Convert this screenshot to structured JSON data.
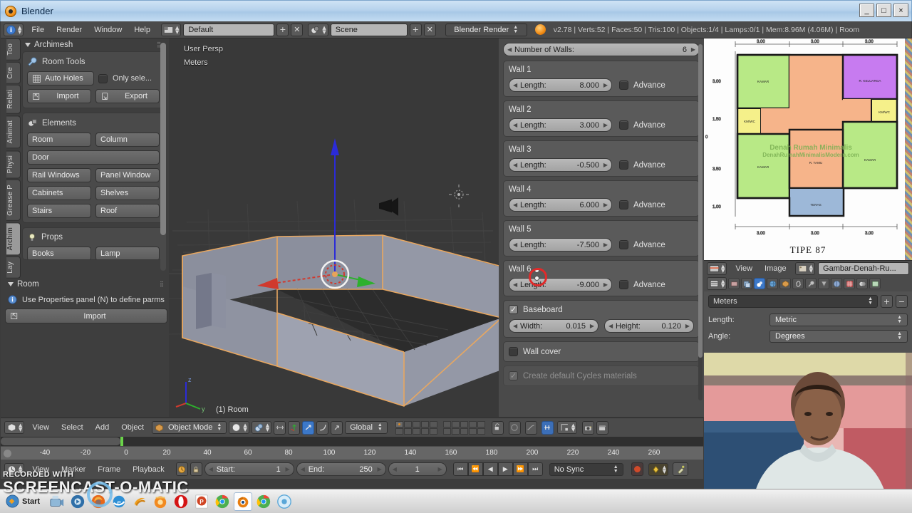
{
  "window": {
    "title": "Blender",
    "app_icon": "blender-logo-icon",
    "controls": {
      "minimize": "_",
      "maximize": "□",
      "close": "×"
    }
  },
  "info_header": {
    "editor_icon": "info-editor-icon",
    "menus": [
      "File",
      "Render",
      "Window",
      "Help"
    ],
    "screen_layout_icon": "screen-layout-icon",
    "screen_layout": "Default",
    "add_screen": "+",
    "delete_screen": "✕",
    "scene_icon": "scene-icon",
    "scene": "Scene",
    "add_scene": "+",
    "delete_scene": "✕",
    "render_engine": "Blender Render",
    "blender_icon": "blender-logo-icon",
    "stats": "v2.78 | Verts:52 | Faces:50 | Tris:100 | Objects:1/4 | Lamps:0/1 | Mem:8.96M (4.06M) | Room"
  },
  "tool_shelf": {
    "tabs": [
      {
        "label": "Too",
        "active": false
      },
      {
        "label": "Cre",
        "active": false
      },
      {
        "label": "Relati",
        "active": false
      },
      {
        "label": "Animat",
        "active": false
      },
      {
        "label": "Physi",
        "active": false
      },
      {
        "label": "Grease P",
        "active": false
      },
      {
        "label": "Archim",
        "active": true
      },
      {
        "label": "Lay",
        "active": false
      }
    ],
    "archimesh": {
      "title": "Archimesh",
      "room_tools": {
        "header": "Room Tools",
        "header_icon": "wrench-icon",
        "auto_holes": "Auto Holes",
        "auto_holes_icon": "grid-holes-icon",
        "only_selected": "Only sele...",
        "only_selected_checked": false,
        "import": "Import",
        "import_icon": "import-icon",
        "export": "Export",
        "export_icon": "export-icon"
      },
      "elements": {
        "header": "Elements",
        "header_icon": "objects-icon",
        "buttons": [
          "Room",
          "Column",
          "Door",
          "Rail Windows",
          "Panel Window",
          "Cabinets",
          "Shelves",
          "Stairs",
          "Roof"
        ]
      },
      "props": {
        "header": "Props",
        "header_icon": "lightbulb-icon",
        "buttons": [
          "Books",
          "Lamp"
        ]
      }
    },
    "room_panel": {
      "title": "Room",
      "info_icon": "info-icon",
      "hint": "Use Properties panel (N) to define parms",
      "import": "Import",
      "import_icon": "import-icon"
    }
  },
  "viewport": {
    "view_perspective": "User Persp",
    "unit_label": "Meters",
    "object_label": "(1) Room",
    "axis_gizmo": {
      "z": "z",
      "y": "y",
      "x": "x"
    },
    "colors": {
      "selection_outline": "#e8a760",
      "axis_x": "#d03a2e",
      "axis_y": "#2db02d",
      "axis_z": "#2b2bd8"
    },
    "footer": {
      "editor_icon": "3d-view-icon",
      "menus": [
        "View",
        "Select",
        "Add",
        "Object"
      ],
      "mode_icon": "object-mode-cube-icon",
      "mode": "Object Mode",
      "shading_icon": "shading-solid-icon",
      "pivot_icon": "pivot-median-icon",
      "snap_icon": "snap-magnet-icon",
      "manipulator_translate_icon": "manipulator-translate-icon",
      "manipulator_rotate_icon": "manipulator-rotate-icon",
      "manipulator_scale_icon": "manipulator-scale-icon",
      "orientation": "Global",
      "proportional_icon": "proportional-edit-icon",
      "render_icon": "render-camera-icon",
      "viewport_render_icon": "viewport-render-icon"
    }
  },
  "archimesh_params": {
    "number_of_walls": {
      "label": "Number of Walls:",
      "value": "6"
    },
    "walls": [
      {
        "name": "Wall 1",
        "length_label": "Length:",
        "length": "8.000",
        "advance_label": "Advance",
        "advance": false
      },
      {
        "name": "Wall 2",
        "length_label": "Length:",
        "length": "3.000",
        "advance_label": "Advance",
        "advance": false
      },
      {
        "name": "Wall 3",
        "length_label": "Length:",
        "length": "-0.500",
        "advance_label": "Advance",
        "advance": false
      },
      {
        "name": "Wall 4",
        "length_label": "Length:",
        "length": "6.000",
        "advance_label": "Advance",
        "advance": false
      },
      {
        "name": "Wall 5",
        "length_label": "Length:",
        "length": "-7.500",
        "advance_label": "Advance",
        "advance": false
      },
      {
        "name": "Wall 6",
        "length_label": "Length:",
        "length": "-9.000",
        "advance_label": "Advance",
        "advance": false
      }
    ],
    "baseboard": {
      "label": "Baseboard",
      "checked": true,
      "width_label": "Width:",
      "width": "0.015",
      "height_label": "Height:",
      "height": "0.120"
    },
    "wall_cover": {
      "label": "Wall cover",
      "checked": false
    },
    "cycles_materials": {
      "label": "Create default Cycles materials",
      "checked": true,
      "disabled": true
    }
  },
  "image_editor": {
    "editor_icon": "uv-image-editor-icon",
    "menus": [
      "View",
      "Image"
    ],
    "image_icon": "image-datablock-icon",
    "image_name": "Gambar-Denah-Ru...",
    "floorplan": {
      "title": "TIPE 87",
      "top_dims": [
        "3.00",
        "3.00",
        "3.00"
      ],
      "bottom_dims": [
        "3.00",
        "3.00",
        "3.00"
      ],
      "left_dims": [
        "3.00",
        "1.50",
        "0",
        "3.50",
        "1.00"
      ],
      "rooms": [
        {
          "name": "KAMAR",
          "color": "#b8e986"
        },
        {
          "name": "R. KELUARGA",
          "color": "#c77bf0"
        },
        {
          "name": "KM/WC",
          "color": "#f5f08a"
        },
        {
          "name": "KM/WC",
          "color": "#f5f08a"
        },
        {
          "name": "KAMAR",
          "color": "#b8e986"
        },
        {
          "name": "KAMAR",
          "color": "#b8e986"
        },
        {
          "name": "R. TAMU",
          "color": "#f6b48a"
        },
        {
          "name": "TERAS",
          "color": "#9db8d8"
        }
      ],
      "watermark_lines": [
        "Denah Rumah Minimalis",
        "DenahRumahMinimalisModern.com"
      ]
    }
  },
  "properties_editor": {
    "editor_icon": "properties-editor-icon",
    "tab_icons": [
      "render-icon",
      "render-layers-icon",
      "scene-icon",
      "world-icon",
      "object-icon",
      "constraints-icon",
      "modifiers-icon",
      "particles-icon",
      "physics-icon",
      "object-data-icon",
      "material-icon",
      "texture-icon"
    ],
    "active_tab": "scene-icon",
    "unit_system_value": "Meters",
    "add_button": "+",
    "remove_button": "−",
    "rows": [
      {
        "label": "Length:",
        "value": "Metric"
      },
      {
        "label": "Angle:",
        "value": "Degrees"
      }
    ]
  },
  "timeline": {
    "ticks": [
      "-40",
      "-20",
      "0",
      "20",
      "40",
      "60",
      "80",
      "100",
      "120",
      "140",
      "160",
      "180",
      "200",
      "220",
      "240",
      "260"
    ],
    "editor_icon": "timeline-icon",
    "menus": [
      "View",
      "Marker",
      "Frame",
      "Playback"
    ],
    "use_preview_icon": "preview-range-icon",
    "lock_icon": "lock-icon",
    "start_label": "Start:",
    "start_value": "1",
    "end_label": "End:",
    "end_value": "250",
    "current_frame": "1",
    "transport": [
      "⏮",
      "⏪",
      "◀",
      "▶",
      "⏩",
      "⏭"
    ],
    "sync_mode": "No Sync",
    "record_icon": "record-icon",
    "keying_set_icon": "keying-set-icon",
    "keyframe_type_icon": "keyframe-type-icon"
  },
  "watermark": {
    "line1": "RECORDED WITH",
    "line2": "SCREENCAST-O-MATIC"
  },
  "taskbar": {
    "start_label": "Start",
    "items": [
      {
        "name": "start-button-icon",
        "color": "#4aa3df"
      },
      {
        "name": "screencast-o-matic-icon",
        "color": "#5ab0e0"
      },
      {
        "name": "media-player-icon",
        "color": "#3d7fbf"
      },
      {
        "name": "firefox-icon",
        "color": "#e8681a"
      },
      {
        "name": "internet-explorer-icon",
        "color": "#2d8fd5"
      },
      {
        "name": "idm-icon",
        "color": "#f0a020"
      },
      {
        "name": "sunrise-browser-icon",
        "color": "#f28a20"
      },
      {
        "name": "opera-icon",
        "color": "#d41414"
      },
      {
        "name": "powerpoint-icon",
        "color": "#d04423"
      },
      {
        "name": "chrome-icon",
        "color": "#4caf50"
      },
      {
        "name": "blender-icon",
        "color": "#e87d0d",
        "active": true
      },
      {
        "name": "chrome-icon",
        "color": "#4caf50"
      },
      {
        "name": "disc-icon",
        "color": "#5aa7d8"
      }
    ]
  }
}
